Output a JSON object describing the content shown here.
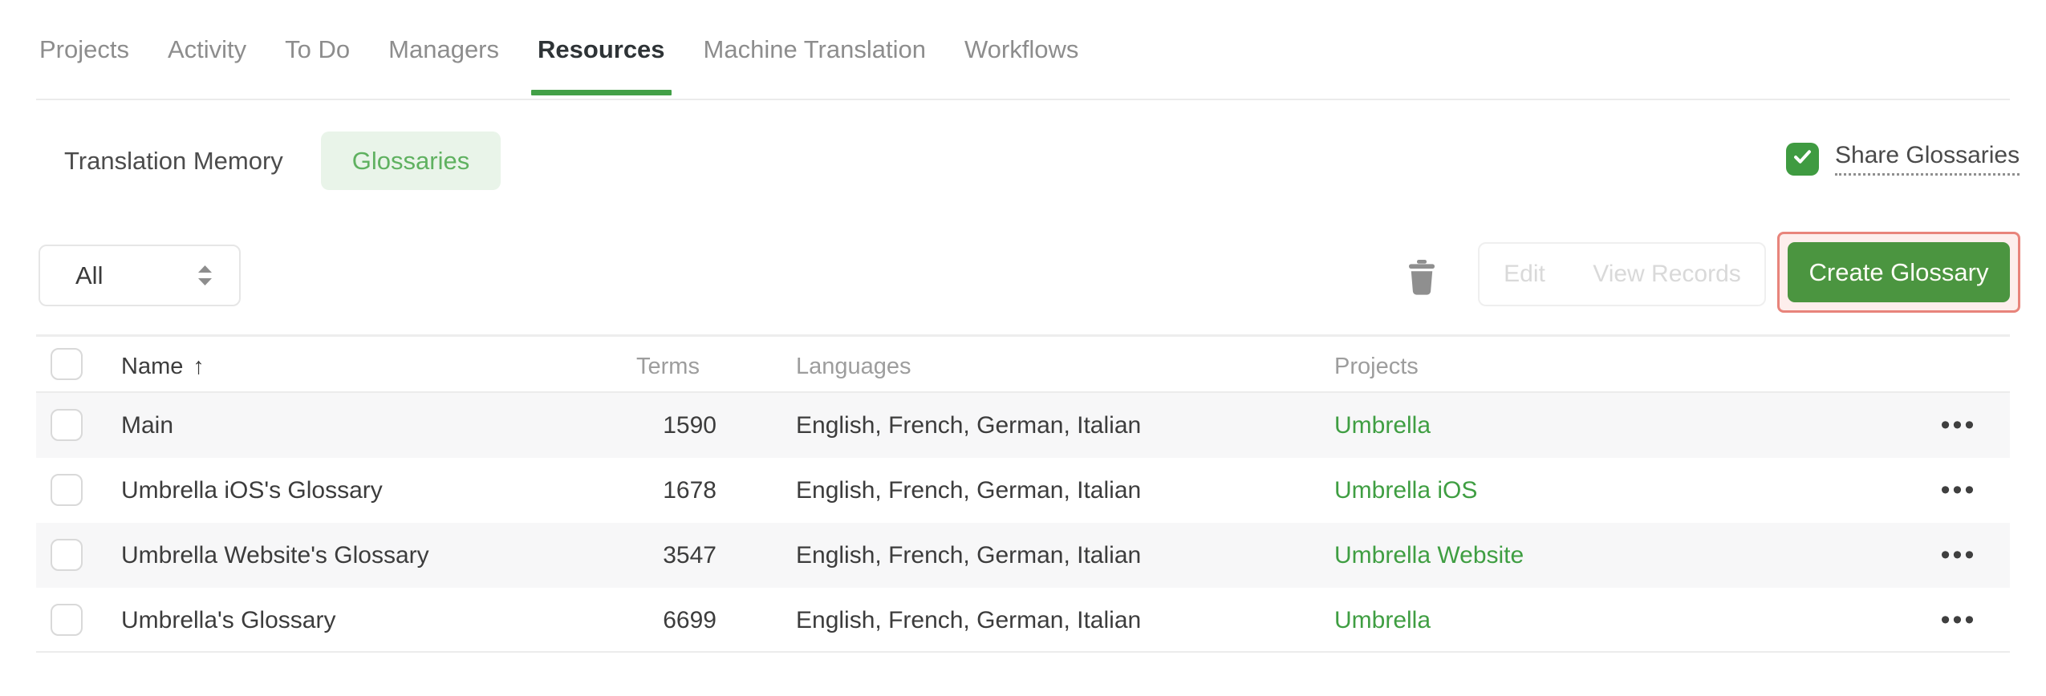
{
  "nav": {
    "tabs": [
      {
        "label": "Projects",
        "active": false
      },
      {
        "label": "Activity",
        "active": false
      },
      {
        "label": "To Do",
        "active": false
      },
      {
        "label": "Managers",
        "active": false
      },
      {
        "label": "Resources",
        "active": true
      },
      {
        "label": "Machine Translation",
        "active": false
      },
      {
        "label": "Workflows",
        "active": false
      }
    ]
  },
  "subnav": {
    "tabs": [
      {
        "label": "Translation Memory",
        "active": false
      },
      {
        "label": "Glossaries",
        "active": true
      }
    ],
    "share": {
      "label": "Share Glossaries",
      "checked": true
    }
  },
  "toolbar": {
    "filter": {
      "value": "All"
    },
    "icons": {
      "trash": "trash-icon",
      "sorter": "sort-arrows-icon",
      "check": "check-icon"
    },
    "edit_label": "Edit",
    "view_records_label": "View Records",
    "create_label": "Create Glossary",
    "create_highlighted": true
  },
  "table": {
    "header": {
      "name": "Name",
      "terms": "Terms",
      "languages": "Languages",
      "projects": "Projects"
    },
    "sort": {
      "column": "Name",
      "direction": "asc",
      "arrow": "↑"
    },
    "row_menu_glyph": "•••",
    "rows": [
      {
        "name": "Main",
        "terms": "1590",
        "languages": "English, French, German, Italian",
        "project": "Umbrella"
      },
      {
        "name": "Umbrella iOS's Glossary",
        "terms": "1678",
        "languages": "English, French, German, Italian",
        "project": "Umbrella iOS"
      },
      {
        "name": "Umbrella Website's Glossary",
        "terms": "3547",
        "languages": "English, French, German, Italian",
        "project": "Umbrella Website"
      },
      {
        "name": "Umbrella's Glossary",
        "terms": "6699",
        "languages": "English, French, German, Italian",
        "project": "Umbrella"
      }
    ]
  },
  "colors": {
    "accent_green": "#43a047",
    "link_green": "#3f9e42",
    "button_green": "#4b9540",
    "pill_bg": "#e9f4e9",
    "pill_text": "#5fb160",
    "annotation_border": "#e8847b",
    "annotation_bg": "#fdeeec",
    "striped_row": "#f7f7f8",
    "border_gray": "#ececec",
    "disabled_text": "#d9d9d9"
  }
}
